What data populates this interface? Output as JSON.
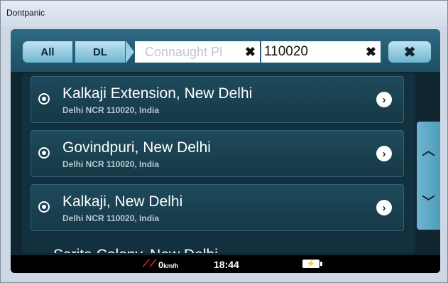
{
  "window": {
    "title": "Dontpanic"
  },
  "search": {
    "tab_all": "All",
    "tab_dl": "DL",
    "street_placeholder": "Connaught Pl",
    "clear_street": "✖",
    "zip_value": "110020",
    "clear_zip": "✖",
    "close_label": "✖"
  },
  "results": [
    {
      "title": "Kalkaji Extension, New Delhi",
      "subtitle": "Delhi NCR 110020, India"
    },
    {
      "title": "Govindpuri, New Delhi",
      "subtitle": "Delhi NCR 110020, India"
    },
    {
      "title": "Kalkaji, New Delhi",
      "subtitle": "Delhi NCR 110020, India"
    }
  ],
  "partial_result": "Sarita Colony, New Delhi",
  "scroll": {
    "up_icon": "chevron-up-icon",
    "down_icon": "chevron-down-icon"
  },
  "status": {
    "speed": "0",
    "speed_unit": "km/h",
    "time": "18:44",
    "battery_icon": "battery-charging-icon"
  },
  "colors": {
    "accent": "#6fb6d2",
    "panel": "#163946"
  }
}
